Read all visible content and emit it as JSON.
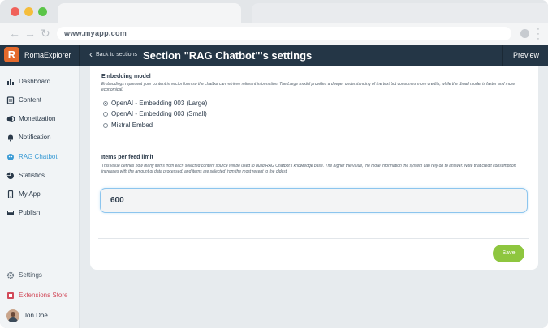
{
  "browser": {
    "url": "www.myapp.com"
  },
  "app": {
    "logo_letter": "R",
    "name": "RomaExplorer",
    "back_label": "Back to sections",
    "section_title": "Section \"RAG Chatbot\"'s settings",
    "preview_label": "Preview"
  },
  "sidebar": {
    "items": [
      {
        "label": "Dashboard",
        "icon": "bar-chart-icon"
      },
      {
        "label": "Content",
        "icon": "document-icon"
      },
      {
        "label": "Monetization",
        "icon": "coins-icon"
      },
      {
        "label": "Notification",
        "icon": "bell-icon"
      },
      {
        "label": "RAG Chatbot",
        "icon": "robot-icon",
        "active": true
      },
      {
        "label": "Statistics",
        "icon": "pie-chart-icon"
      },
      {
        "label": "My App",
        "icon": "phone-icon"
      },
      {
        "label": "Publish",
        "icon": "publish-icon"
      }
    ],
    "bottom": {
      "settings": "Settings",
      "extensions": "Extensions Store",
      "user": "Jon Doe"
    }
  },
  "settings": {
    "embedding": {
      "label": "Embedding model",
      "description": "Embeddings represent your content in vector form so the chatbot can retrieve relevant information. The Large model provides a deeper understanding of the text but consumes more credits, while the Small model is faster and more economical.",
      "options": [
        {
          "label": "OpenAI - Embedding 003 (Large)",
          "selected": true
        },
        {
          "label": "OpenAI - Embedding 003 (Small)",
          "selected": false
        },
        {
          "label": "Mistral Embed",
          "selected": false
        }
      ]
    },
    "items_limit": {
      "label": "Items per feed limit",
      "description": "This value defines how many items from each selected content source will be used to build RAG Chatbot's knowledge base. The higher the value, the more information the system can rely on to answer. Note that credit consumption increases with the amount of data processed, and items are selected from the most recent to the oldest.",
      "value": "600"
    },
    "save_label": "Save"
  },
  "colors": {
    "header_bg": "#243646",
    "accent_blue": "#3a9bd5",
    "save_green": "#8ec63f",
    "logo_orange": "#e56a2c",
    "extensions_red": "#d24a5a"
  }
}
